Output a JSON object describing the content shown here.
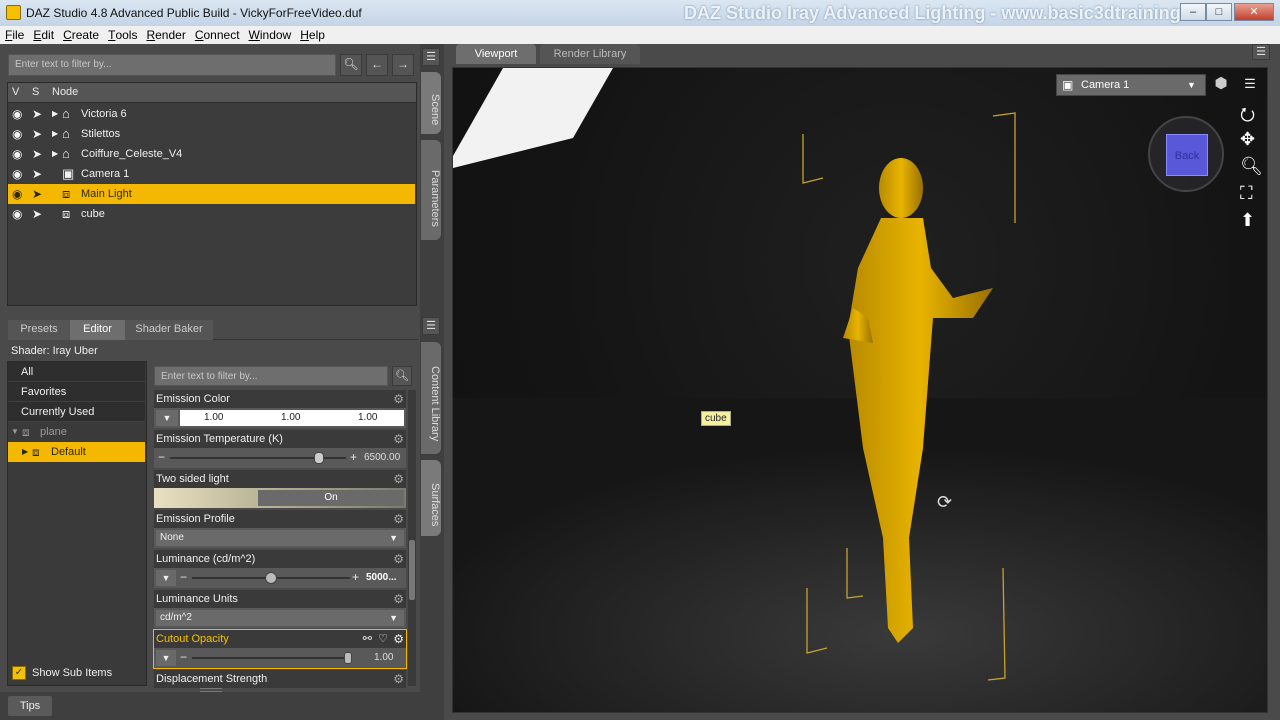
{
  "window": {
    "title": "DAZ Studio 4.8 Advanced Public Build - VickyForFreeVideo.duf",
    "watermark": "DAZ Studio Iray Advanced Lighting - www.basic3dtraining.com",
    "min_label": "–",
    "max_label": "□",
    "close_label": "✕"
  },
  "menu": [
    {
      "label": "File",
      "u": "F",
      "rest": "ile"
    },
    {
      "label": "Edit",
      "u": "E",
      "rest": "dit"
    },
    {
      "label": "Create",
      "u": "C",
      "rest": "reate"
    },
    {
      "label": "Tools",
      "u": "T",
      "rest": "ools"
    },
    {
      "label": "Render",
      "u": "R",
      "rest": "ender"
    },
    {
      "label": "Connect",
      "u": "C",
      "rest": "onnect"
    },
    {
      "label": "Window",
      "u": "W",
      "rest": "indow"
    },
    {
      "label": "Help",
      "u": "H",
      "rest": "elp"
    }
  ],
  "scene": {
    "filter_placeholder": "Enter text to filter by...",
    "columns": {
      "v": "V",
      "s": "S",
      "node": "Node"
    },
    "nodes": [
      {
        "label": "Victoria 6",
        "icon": "figure-icon",
        "glyph": "⌂",
        "expandable": true,
        "selected": false
      },
      {
        "label": "Stilettos",
        "icon": "figure-icon",
        "glyph": "⌂",
        "expandable": true,
        "selected": false
      },
      {
        "label": "Coiffure_Celeste_V4",
        "icon": "figure-icon",
        "glyph": "⌂",
        "expandable": true,
        "selected": false
      },
      {
        "label": "Camera 1",
        "icon": "camera-icon",
        "glyph": "▣",
        "expandable": false,
        "selected": false
      },
      {
        "label": "Main Light",
        "icon": "cube-icon",
        "glyph": "⧈",
        "expandable": false,
        "selected": true
      },
      {
        "label": "cube",
        "icon": "cube-icon",
        "glyph": "⧈",
        "expandable": false,
        "selected": false
      }
    ]
  },
  "right_tabs": {
    "scene": "Scene",
    "parameters": "Parameters",
    "content_library": "Content Library",
    "surfaces": "Surfaces"
  },
  "surfaces": {
    "tabs": [
      "Presets",
      "Editor",
      "Shader Baker"
    ],
    "active_tab": "Editor",
    "shader_label": "Shader: Iray Uber",
    "categories": [
      "All",
      "Favorites",
      "Currently Used"
    ],
    "tree": {
      "parent": "plane",
      "child": "Default"
    },
    "show_sub_items": "Show Sub Items",
    "filter_placeholder": "Enter text to filter by...",
    "properties": {
      "emission_color": {
        "label": "Emission Color",
        "r": "1.00",
        "g": "1.00",
        "b": "1.00"
      },
      "emission_temp": {
        "label": "Emission Temperature (K)",
        "value": "6500.00",
        "fraction": 0.85
      },
      "two_sided": {
        "label": "Two sided light",
        "value": "On"
      },
      "emission_profile": {
        "label": "Emission Profile",
        "value": "None"
      },
      "luminance": {
        "label": "Luminance (cd/m^2)",
        "value": "5000...",
        "fraction": 0.5
      },
      "luminance_units": {
        "label": "Luminance Units",
        "value": "cd/m^2"
      },
      "cutout_opacity": {
        "label": "Cutout Opacity",
        "value": "1.00",
        "fraction": 1.0
      },
      "displacement": {
        "label": "Displacement Strength"
      }
    }
  },
  "viewport": {
    "tabs": [
      "Viewport",
      "Render Library"
    ],
    "camera": "Camera 1",
    "cube_tag": "cube",
    "nav_cube_label": "Back"
  },
  "bottom": {
    "tips": "Tips"
  }
}
